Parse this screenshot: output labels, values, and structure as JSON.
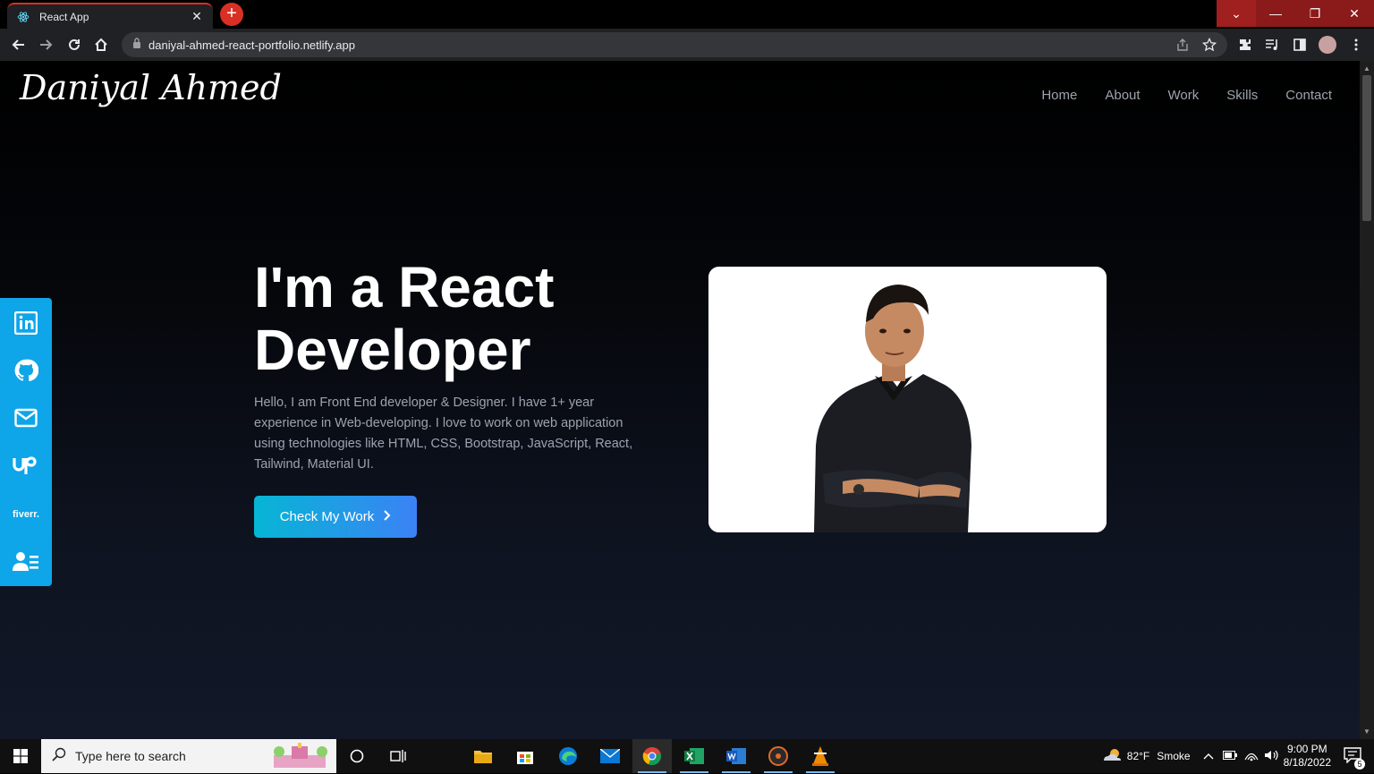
{
  "browser": {
    "tab_title": "React App",
    "url": "daniyal-ahmed-react-portfolio.netlify.app"
  },
  "site": {
    "logo": "Daniyal Ahmed",
    "nav": [
      "Home",
      "About",
      "Work",
      "Skills",
      "Contact"
    ],
    "hero": {
      "title_line1": "I'm a React",
      "title_line2": "Developer",
      "description": "Hello, I am Front End developer & Designer. I have 1+ year experience in Web-developing. I love to work on web application using technologies like HTML, CSS, Bootstrap, JavaScript, React, Tailwind, Material UI.",
      "cta": "Check My Work"
    },
    "social": {
      "fiverr_label": "fiverr."
    }
  },
  "taskbar": {
    "search_placeholder": "Type here to search",
    "weather": "82°F",
    "weather_desc": "Smoke",
    "time": "9:00 PM",
    "date": "8/18/2022",
    "notifications": "5"
  },
  "colors": {
    "accent": "#0ea5e9",
    "cta_start": "#06b6d4",
    "cta_end": "#3b82f6",
    "tab_accent": "#d93025"
  }
}
